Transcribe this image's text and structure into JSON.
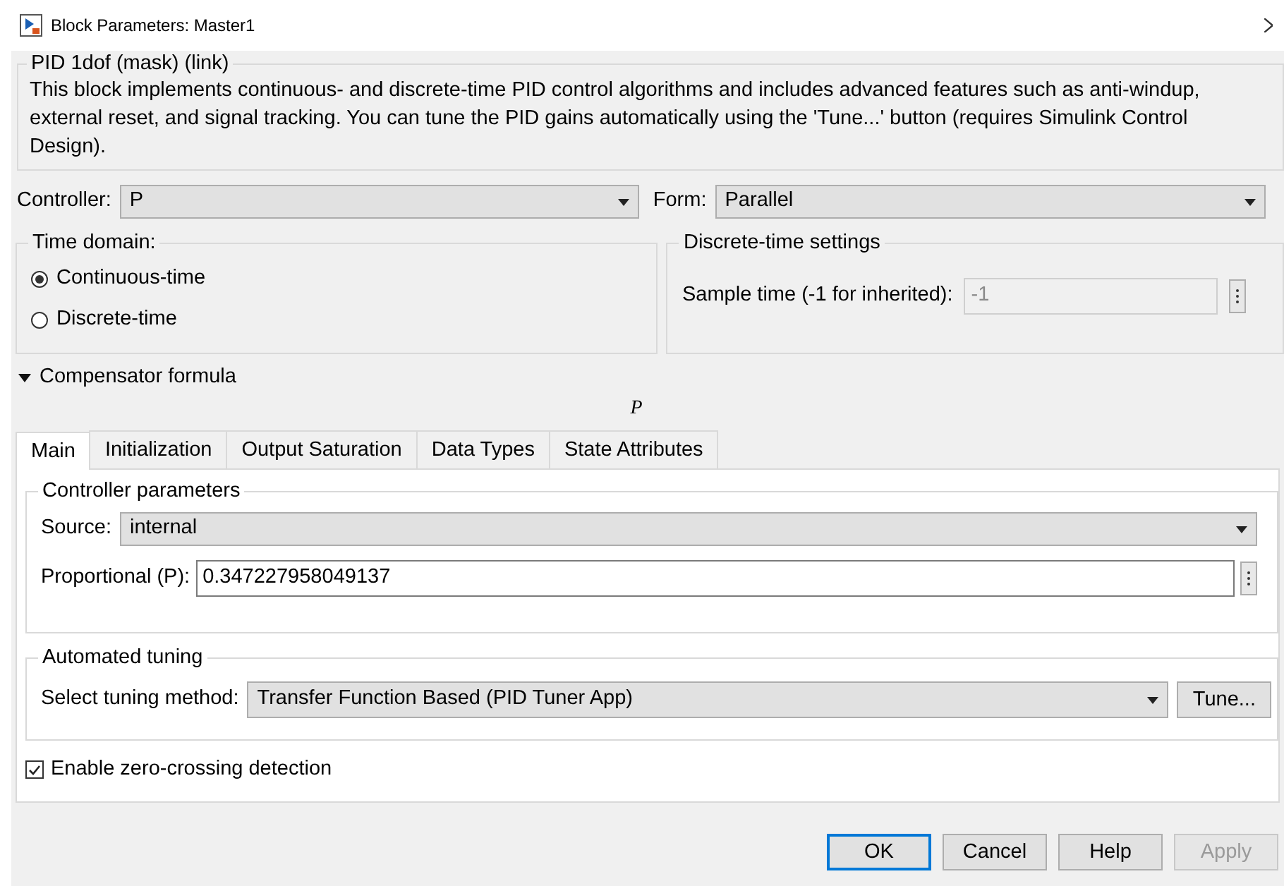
{
  "window": {
    "title": "Block Parameters: Master1"
  },
  "description": {
    "title": "PID 1dof (mask) (link)",
    "text": "This block implements continuous- and discrete-time PID control algorithms and includes advanced features such as anti-windup, external reset, and signal tracking. You can tune the PID gains automatically using the 'Tune...' button (requires Simulink Control Design)."
  },
  "controller": {
    "label": "Controller:",
    "value": "P"
  },
  "form": {
    "label": "Form:",
    "value": "Parallel"
  },
  "time_domain": {
    "title": "Time domain:",
    "options": [
      {
        "label": "Continuous-time",
        "selected": true
      },
      {
        "label": "Discrete-time",
        "selected": false
      }
    ]
  },
  "discrete_settings": {
    "title": "Discrete-time settings",
    "sample_time": {
      "label": "Sample time (-1 for inherited):",
      "value": "-1",
      "disabled": true
    }
  },
  "compensator": {
    "label": "Compensator formula",
    "expanded": true,
    "formula": "P"
  },
  "tabs": [
    {
      "label": "Main",
      "selected": true
    },
    {
      "label": "Initialization",
      "selected": false
    },
    {
      "label": "Output Saturation",
      "selected": false
    },
    {
      "label": "Data Types",
      "selected": false
    },
    {
      "label": "State Attributes",
      "selected": false
    }
  ],
  "controller_parameters": {
    "title": "Controller parameters",
    "source": {
      "label": "Source:",
      "value": "internal"
    },
    "proportional": {
      "label": "Proportional (P):",
      "value": "0.347227958049137"
    }
  },
  "automated_tuning": {
    "title": "Automated tuning",
    "method": {
      "label": "Select tuning method:",
      "value": "Transfer Function Based (PID Tuner App)"
    },
    "tune_button": "Tune..."
  },
  "zero_crossing": {
    "label": "Enable zero-crossing detection",
    "checked": true
  },
  "buttons": [
    {
      "label": "OK",
      "default": true,
      "disabled": false
    },
    {
      "label": "Cancel",
      "default": false,
      "disabled": false
    },
    {
      "label": "Help",
      "default": false,
      "disabled": false
    },
    {
      "label": "Apply",
      "default": false,
      "disabled": true
    }
  ]
}
